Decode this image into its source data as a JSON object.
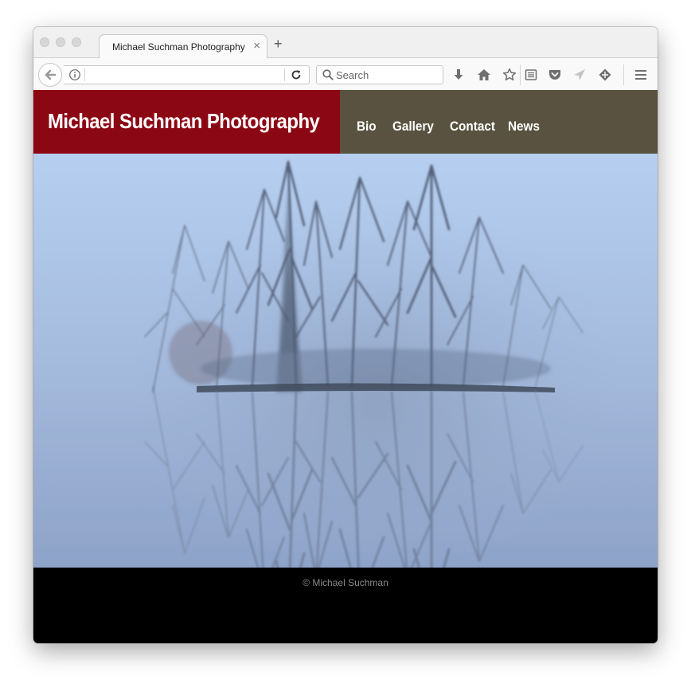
{
  "browser": {
    "tab": {
      "title": "Michael Suchman Photography",
      "close": "×"
    },
    "new_tab": "+",
    "url": "",
    "search": {
      "placeholder": "Search",
      "value": ""
    },
    "toolbar_icons": [
      "download-icon",
      "home-icon",
      "bookmark-star-icon",
      "reading-list-icon",
      "pocket-icon",
      "send-icon",
      "sync-icon",
      "hamburger-menu-icon"
    ]
  },
  "site": {
    "title": "Michael Suchman Photography",
    "nav": [
      "Bio",
      "Gallery",
      "Contact",
      "News"
    ],
    "footer": "© Michael Suchman",
    "colors": {
      "brand": "#8c0714",
      "nav_bg": "#5a5240",
      "footer_bg": "#000000"
    }
  }
}
